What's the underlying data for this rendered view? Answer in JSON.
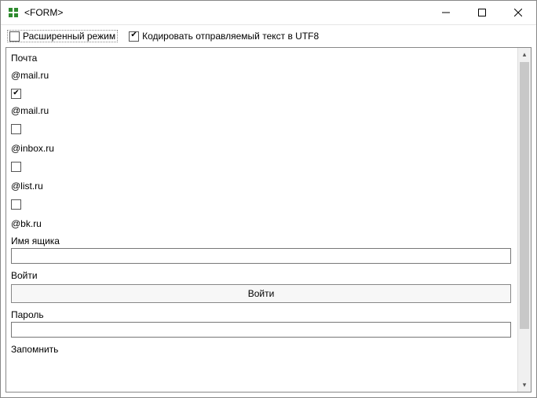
{
  "window": {
    "title": "<FORM>"
  },
  "toolbar": {
    "extended_mode_label": "Расширенный режим",
    "extended_mode_checked": false,
    "utf8_label": "Кодировать отправляемый текст в UTF8",
    "utf8_checked": true
  },
  "form": {
    "mail_header": "Почта",
    "mail_default": "@mail.ru",
    "domains": [
      {
        "label": "@mail.ru",
        "checked": true
      },
      {
        "label": "@inbox.ru",
        "checked": false
      },
      {
        "label": "@list.ru",
        "checked": false
      },
      {
        "label": "@bk.ru",
        "checked": false
      }
    ],
    "mailbox_label": "Имя ящика",
    "mailbox_value": "",
    "login_label": "Войти",
    "login_button": "Войти",
    "password_label": "Пароль",
    "password_value": "",
    "remember_label": "Запомнить"
  }
}
